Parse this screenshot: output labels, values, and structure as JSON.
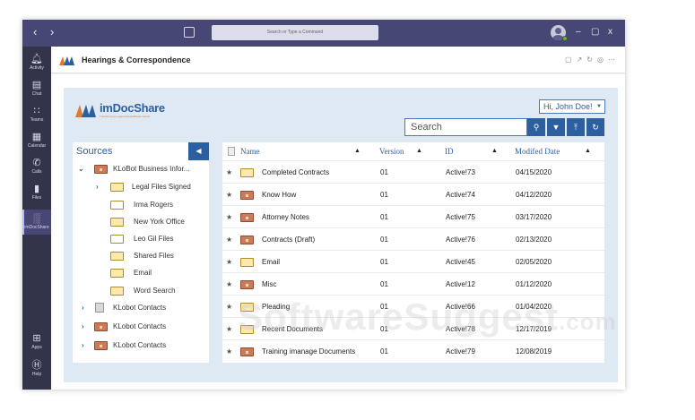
{
  "titlebar": {
    "back_icon": "chevron-left",
    "forward_icon": "chevron-right",
    "search_placeholder": "Search or Type a Command",
    "controls": [
      "–",
      "▢",
      "x"
    ]
  },
  "rail": {
    "items": [
      {
        "label": "Activity",
        "icon": "bell-icon"
      },
      {
        "label": "Chat",
        "icon": "chat-icon"
      },
      {
        "label": "Teams",
        "icon": "teams-icon"
      },
      {
        "label": "Calendar",
        "icon": "calendar-icon"
      },
      {
        "label": "Calls",
        "icon": "phone-icon"
      },
      {
        "label": "Files",
        "icon": "file-icon"
      },
      {
        "label": "imDocShare",
        "icon": "imdocshare-icon"
      }
    ],
    "bottom": [
      {
        "label": "Apps",
        "icon": "apps-icon"
      },
      {
        "label": "Help",
        "icon": "help-icon"
      }
    ]
  },
  "app": {
    "title": "Hearings & Correspondence"
  },
  "brand": {
    "name": "imDocShare",
    "tagline": "Transforming Legal and Healthcare Sector"
  },
  "user_menu": {
    "label": "Hi, John Doe!"
  },
  "search": {
    "placeholder": "Search"
  },
  "sources": {
    "title": "Sources",
    "items": [
      {
        "label": "KLoBot Business Infor...",
        "chevron": "⌄",
        "icon": "brief"
      },
      {
        "label": "Legal Files Signed",
        "chevron": "›",
        "icon": "folder"
      },
      {
        "label": "Irma Rogers",
        "chevron": "",
        "icon": "outline"
      },
      {
        "label": "New York Office",
        "chevron": "",
        "icon": "folder"
      },
      {
        "label": "Leo Gil Files",
        "chevron": "",
        "icon": "outline"
      },
      {
        "label": "Shared Files",
        "chevron": "",
        "icon": "folder"
      },
      {
        "label": "Email",
        "chevron": "",
        "icon": "folder"
      },
      {
        "label": "Word Search",
        "chevron": "",
        "icon": "folder"
      },
      {
        "label": "KLobot Contacts",
        "chevron": "›",
        "icon": "doc"
      },
      {
        "label": "KLobot Contacts",
        "chevron": "›",
        "icon": "brief"
      },
      {
        "label": "KLobot Contacts",
        "chevron": "›",
        "icon": "brief"
      }
    ]
  },
  "grid": {
    "columns": {
      "name": "Name",
      "version": "Version",
      "id": "ID",
      "modified": "Modifed Date"
    },
    "rows": [
      {
        "name": "Completed Contracts",
        "version": "01",
        "id": "Active!73",
        "date": "04/15/2020",
        "icon": "folder"
      },
      {
        "name": "Know How",
        "version": "01",
        "id": "Active!74",
        "date": "04/12/2020",
        "icon": "brief"
      },
      {
        "name": "Attorney Notes",
        "version": "01",
        "id": "Active!75",
        "date": "03/17/2020",
        "icon": "brief"
      },
      {
        "name": "Contracts (Draft)",
        "version": "01",
        "id": "Active!76",
        "date": "02/13/2020",
        "icon": "brief"
      },
      {
        "name": "Email",
        "version": "01",
        "id": "Active!45",
        "date": "02/05/2020",
        "icon": "folder"
      },
      {
        "name": "Misc",
        "version": "01",
        "id": "Active!12",
        "date": "01/12/2020",
        "icon": "brief"
      },
      {
        "name": "Pleading",
        "version": "01",
        "id": "Active!66",
        "date": "01/04/2020",
        "icon": "folder"
      },
      {
        "name": "Recent Documents",
        "version": "01",
        "id": "Active!78",
        "date": "12/17/2019",
        "icon": "folder"
      },
      {
        "name": "Training imanage Documents",
        "version": "01",
        "id": "Active!79",
        "date": "12/08/2019",
        "icon": "brief"
      }
    ]
  },
  "watermark": {
    "text": "SoftwareSuggest",
    "suffix": ".com"
  },
  "colors": {
    "titlebar": "#464775",
    "rail": "#33344a",
    "accent": "#2c5fa0",
    "panel": "#dfe9f3"
  }
}
